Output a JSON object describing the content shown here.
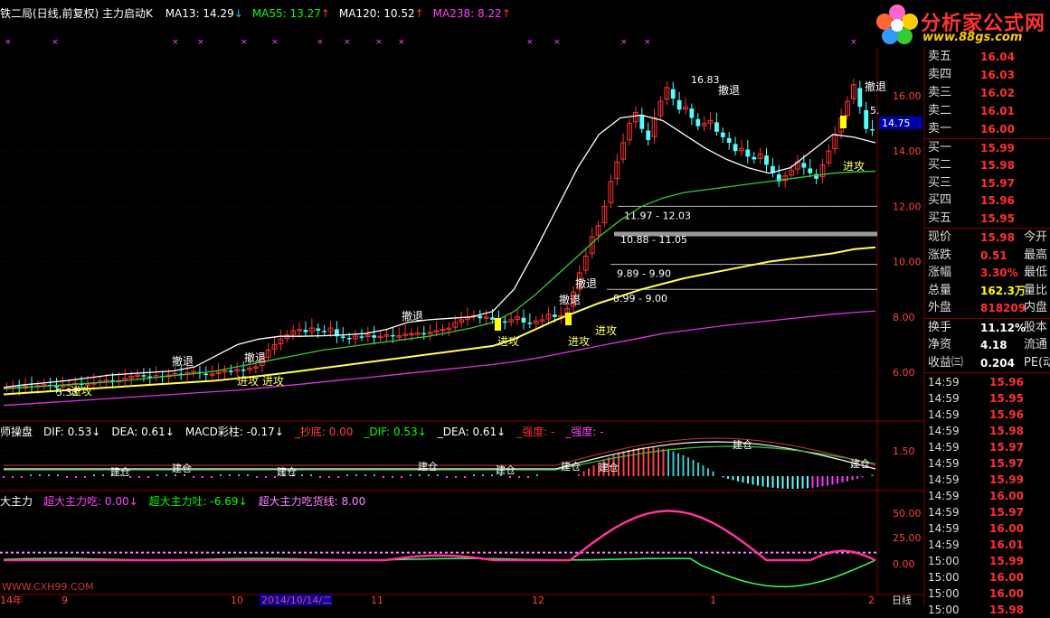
{
  "header": {
    "title": "铁二局(日线,前复权) 主力启动K",
    "ma": [
      {
        "label": "MA13: 14.29",
        "arrow": "↓",
        "color": "#ffffff",
        "arrowColor": "#00ccff"
      },
      {
        "label": "MA55: 13.27",
        "arrow": "↑",
        "color": "#00ff00",
        "arrowColor": "#ff3030"
      },
      {
        "label": "MA120: 10.52",
        "arrow": "↑",
        "color": "#ffffff",
        "arrowColor": "#ff3030"
      },
      {
        "label": "MA238: 8.22",
        "arrow": "↑",
        "color": "#ff40ff",
        "arrowColor": "#ff3030"
      }
    ]
  },
  "logo": {
    "text": "分析家公式网",
    "url": "www.88gs.com"
  },
  "macd_header": {
    "items": [
      {
        "text": "师操盘",
        "color": "#ffffff"
      },
      {
        "text": "DIF: 0.53↓",
        "color": "#ffffff"
      },
      {
        "text": "DEA: 0.61↓",
        "color": "#ffffff"
      },
      {
        "text": "MACD彩柱: -0.17↓",
        "color": "#ffffff"
      },
      {
        "text": "_抄底: 0.00",
        "color": "#ff4040"
      },
      {
        "text": "_DIF: 0.53↓",
        "color": "#00ff00"
      },
      {
        "text": "_DEA: 0.61↓",
        "color": "#ffffff"
      },
      {
        "text": "_强度: -",
        "color": "#ff3030"
      },
      {
        "text": "_强度: -",
        "color": "#ff40ff"
      }
    ]
  },
  "main_header": {
    "items": [
      {
        "text": "大主力",
        "color": "#ffffff"
      },
      {
        "text": "超大主力吃: 0.00↓",
        "color": "#ff40ff"
      },
      {
        "text": "超大主力吐: -6.69↓",
        "color": "#00ff00"
      },
      {
        "text": "超大主力吃货线: 8.00",
        "color": "#ff80ff"
      }
    ]
  },
  "price_axis": [
    "16.00",
    "14.00",
    "12.00",
    "10.00",
    "8.00",
    "6.00"
  ],
  "current_price_tag": "14.75",
  "macd_axis": [
    "1.50"
  ],
  "flow_axis": [
    "50.00",
    "25.00",
    "0.00"
  ],
  "date_axis": [
    "14年",
    "9",
    "10",
    "2014/10/14/二",
    "11",
    "12",
    "1",
    "2",
    "日线"
  ],
  "watermark": "WWW.CXH99.COM",
  "annotations": {
    "high": "16.83",
    "low": "5.33",
    "ranges": [
      "11.97 - 12.03",
      "10.88 - 11.05",
      "9.89 - 9.90",
      "8.99 - 9.00"
    ],
    "attack": "进攻",
    "retreat": "撤退",
    "hold": "建仓",
    "right_cut": "5."
  },
  "quote": {
    "asks": [
      {
        "label": "卖五",
        "price": "16.04"
      },
      {
        "label": "卖四",
        "price": "16.03"
      },
      {
        "label": "卖三",
        "price": "16.02"
      },
      {
        "label": "卖二",
        "price": "16.01"
      },
      {
        "label": "卖一",
        "price": "16.00"
      }
    ],
    "bids": [
      {
        "label": "买一",
        "price": "15.99"
      },
      {
        "label": "买二",
        "price": "15.98"
      },
      {
        "label": "买三",
        "price": "15.97"
      },
      {
        "label": "买四",
        "price": "15.96"
      },
      {
        "label": "买五",
        "price": "15.95"
      }
    ],
    "stats": [
      {
        "label": "现价",
        "value": "15.98",
        "extra": "今开",
        "color": "#ff3030"
      },
      {
        "label": "涨跌",
        "value": "0.51",
        "extra": "最高",
        "color": "#ff3030"
      },
      {
        "label": "涨幅",
        "value": "3.30%",
        "extra": "最低",
        "color": "#ff3030"
      },
      {
        "label": "总量",
        "value": "162.3万",
        "extra": "量比",
        "color": "#ffff00"
      },
      {
        "label": "外盘",
        "value": "818209",
        "extra": "内盘",
        "color": "#ff3030"
      }
    ],
    "stats2": [
      {
        "label": "换手",
        "value": "11.12%",
        "extra": "股本"
      },
      {
        "label": "净资",
        "value": "4.18",
        "extra": "流通"
      },
      {
        "label": "收益㈢",
        "value": "0.204",
        "extra": "PE(动"
      }
    ]
  },
  "ticks": [
    {
      "time": "14:59",
      "price": "15.96"
    },
    {
      "time": "14:59",
      "price": "15.95"
    },
    {
      "time": "14:59",
      "price": "15.96"
    },
    {
      "time": "14:59",
      "price": "15.98"
    },
    {
      "time": "14:59",
      "price": "15.97"
    },
    {
      "time": "14:59",
      "price": "15.97"
    },
    {
      "time": "14:59",
      "price": "15.99"
    },
    {
      "time": "14:59",
      "price": "16.00"
    },
    {
      "time": "14:59",
      "price": "15.97"
    },
    {
      "time": "14:59",
      "price": "16.00"
    },
    {
      "time": "14:59",
      "price": "16.01"
    },
    {
      "time": "15:00",
      "price": "15.99"
    },
    {
      "time": "15:00",
      "price": "16.00"
    },
    {
      "time": "15:00",
      "price": "16.00"
    },
    {
      "time": "15:00",
      "price": "15.98"
    }
  ],
  "chart_data": {
    "type": "candlestick",
    "x_axis_labels": [
      "14年",
      "9",
      "10",
      "2014/10/14/二",
      "11",
      "12",
      "1",
      "2"
    ],
    "y_axis_ticks": [
      6,
      8,
      10,
      12,
      14,
      16
    ],
    "ylim": [
      5.0,
      17.2
    ],
    "close_series": [
      5.45,
      5.48,
      5.42,
      5.5,
      5.46,
      5.52,
      5.55,
      5.5,
      5.48,
      5.52,
      5.56,
      5.6,
      5.55,
      5.58,
      5.62,
      5.68,
      5.72,
      5.66,
      5.7,
      5.78,
      5.85,
      5.9,
      5.86,
      5.8,
      5.88,
      5.82,
      5.9,
      5.95,
      5.92,
      5.98,
      6.02,
      5.96,
      5.9,
      5.94,
      6.0,
      6.06,
      6.04,
      6.1,
      6.08,
      6.15,
      6.2,
      6.5,
      6.8,
      7.0,
      7.2,
      7.35,
      7.5,
      7.55,
      7.45,
      7.6,
      7.5,
      7.45,
      7.6,
      7.3,
      7.25,
      7.2,
      7.3,
      7.28,
      7.35,
      7.25,
      7.3,
      7.35,
      7.3,
      7.32,
      7.38,
      7.4,
      7.42,
      7.38,
      7.45,
      7.5,
      7.55,
      7.6,
      7.8,
      7.9,
      8.0,
      8.05,
      7.95,
      8.0,
      7.9,
      7.85,
      7.8,
      7.9,
      8.0,
      7.8,
      7.75,
      7.85,
      7.9,
      8.1,
      8.0,
      8.05,
      8.3,
      8.9,
      9.6,
      10.2,
      10.9,
      11.3,
      12.0,
      12.9,
      13.6,
      14.3,
      15.0,
      15.4,
      14.8,
      14.4,
      15.2,
      15.8,
      16.3,
      15.9,
      15.5,
      15.6,
      15.2,
      14.9,
      15.0,
      15.1,
      14.7,
      14.5,
      14.3,
      14.0,
      14.1,
      13.8,
      13.7,
      13.9,
      13.5,
      13.2,
      12.9,
      13.1,
      13.3,
      13.6,
      13.4,
      13.2,
      13.0,
      13.5,
      14.0,
      14.6,
      15.2,
      15.8,
      16.4,
      15.6,
      14.8,
      14.75
    ],
    "series": [
      {
        "name": "MA13",
        "values": [
          5.45,
          5.55,
          5.62,
          5.7,
          5.8,
          5.9,
          5.95,
          6.0,
          6.05,
          6.2,
          6.6,
          7.0,
          7.2,
          7.3,
          7.3,
          7.32,
          7.35,
          7.4,
          7.55,
          7.8,
          7.9,
          7.95,
          8.0,
          8.2,
          9.0,
          10.4,
          11.9,
          13.4,
          14.6,
          15.2,
          15.3,
          15.1,
          14.6,
          14.1,
          13.7,
          13.4,
          13.2,
          13.4,
          14.0,
          14.6,
          14.5,
          14.3
        ]
      },
      {
        "name": "MA55",
        "values": [
          5.4,
          5.45,
          5.5,
          5.55,
          5.6,
          5.65,
          5.72,
          5.8,
          5.88,
          5.95,
          6.05,
          6.2,
          6.35,
          6.5,
          6.65,
          6.8,
          6.9,
          7.0,
          7.1,
          7.2,
          7.3,
          7.45,
          7.6,
          7.8,
          8.2,
          8.8,
          9.5,
          10.2,
          10.9,
          11.5,
          12.0,
          12.3,
          12.5,
          12.6,
          12.7,
          12.8,
          12.9,
          13.0,
          13.1,
          13.2,
          13.25,
          13.27
        ]
      },
      {
        "name": "MA120",
        "values": [
          5.2,
          5.25,
          5.3,
          5.35,
          5.4,
          5.45,
          5.5,
          5.55,
          5.6,
          5.65,
          5.7,
          5.78,
          5.86,
          5.95,
          6.05,
          6.15,
          6.25,
          6.35,
          6.45,
          6.55,
          6.65,
          6.75,
          6.85,
          6.95,
          7.2,
          7.55,
          7.9,
          8.2,
          8.5,
          8.75,
          9.0,
          9.2,
          9.4,
          9.55,
          9.7,
          9.85,
          10.0,
          10.1,
          10.2,
          10.3,
          10.45,
          10.52
        ]
      },
      {
        "name": "MA238",
        "values": [
          4.8,
          4.85,
          4.9,
          4.95,
          5.0,
          5.05,
          5.1,
          5.15,
          5.2,
          5.25,
          5.3,
          5.35,
          5.42,
          5.5,
          5.57,
          5.65,
          5.73,
          5.8,
          5.88,
          5.96,
          6.04,
          6.12,
          6.2,
          6.28,
          6.38,
          6.5,
          6.65,
          6.8,
          6.95,
          7.1,
          7.25,
          7.4,
          7.5,
          7.6,
          7.7,
          7.78,
          7.86,
          7.94,
          8.02,
          8.1,
          8.16,
          8.22
        ]
      }
    ],
    "resistance_levels": [
      12.0,
      11.0,
      9.9,
      9.0
    ],
    "macd": {
      "dif": 0.53,
      "dea": 0.61,
      "bar": -0.17
    },
    "flow": {
      "buy": 0.0,
      "sell": -6.69,
      "line": 8.0,
      "ylim": [
        -15,
        60
      ],
      "ticks": [
        50,
        25,
        0
      ]
    }
  }
}
